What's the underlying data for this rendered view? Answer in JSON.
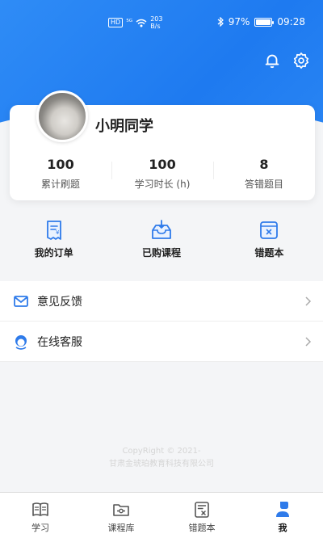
{
  "status_bar": {
    "hd": "HD",
    "signal": "⁵ᴳ",
    "speed_top": "203",
    "speed_bottom": "B/s",
    "battery": "97%",
    "time": "09:28"
  },
  "header": {
    "icons": [
      "bell-icon",
      "gear-icon"
    ]
  },
  "profile": {
    "username": "小明同学",
    "stats": [
      {
        "value": "100",
        "label": "累计刷题"
      },
      {
        "value": "100",
        "label": "学习时长 (h)"
      },
      {
        "value": "8",
        "label": "答错题目"
      }
    ]
  },
  "quick_actions": [
    {
      "label": "我的订单",
      "icon": "receipt-icon"
    },
    {
      "label": "已购课程",
      "icon": "inbox-download-icon"
    },
    {
      "label": "错题本",
      "icon": "wrong-book-icon"
    }
  ],
  "menu": [
    {
      "label": "意见反馈",
      "icon": "mail-icon"
    },
    {
      "label": "在线客服",
      "icon": "customer-service-icon"
    }
  ],
  "copyright": {
    "line1": "CopyRight © 2021-",
    "line2": "甘肃金琥珀教育科技有限公司"
  },
  "tabbar": [
    {
      "label": "学习",
      "icon": "book-icon"
    },
    {
      "label": "课程库",
      "icon": "folder-icon"
    },
    {
      "label": "错题本",
      "icon": "wrong-book-icon"
    },
    {
      "label": "我",
      "icon": "person-icon",
      "active": true
    }
  ],
  "colors": {
    "primary": "#1e7af0",
    "accent_blue": "#2f7bea"
  }
}
